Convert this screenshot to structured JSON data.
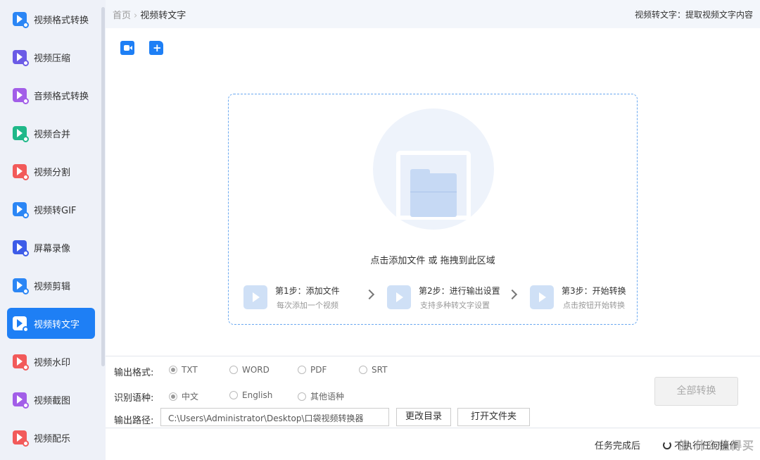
{
  "sidebar": {
    "items": [
      {
        "label": "视频格式转换",
        "icon": "video-convert-icon",
        "color": "#2b86f5"
      },
      {
        "label": "视频压缩",
        "icon": "video-compress-icon",
        "color": "#6b5be6"
      },
      {
        "label": "音频格式转换",
        "icon": "audio-convert-icon",
        "color": "#a25ee8"
      },
      {
        "label": "视频合并",
        "icon": "video-merge-icon",
        "color": "#1fb889"
      },
      {
        "label": "视频分割",
        "icon": "video-split-icon",
        "color": "#f25a5a"
      },
      {
        "label": "视频转GIF",
        "icon": "video-gif-icon",
        "color": "#2b86f5"
      },
      {
        "label": "屏幕录像",
        "icon": "screen-record-icon",
        "color": "#3d5ce8"
      },
      {
        "label": "视频剪辑",
        "icon": "video-edit-icon",
        "color": "#2b86f5"
      },
      {
        "label": "视频转文字",
        "icon": "video-text-icon",
        "color": "#1e7ff5",
        "active": true
      },
      {
        "label": "视频水印",
        "icon": "video-watermark-icon",
        "color": "#f25a5a"
      },
      {
        "label": "视频截图",
        "icon": "video-screenshot-icon",
        "color": "#a25ee8"
      },
      {
        "label": "视频配乐",
        "icon": "video-music-icon",
        "color": "#f25a5a"
      }
    ]
  },
  "header": {
    "breadcrumb_home": "首页",
    "breadcrumb_sep": "›",
    "breadcrumb_current": "视频转文字",
    "description": "视频转文字：提取视频文字内容"
  },
  "dropzone": {
    "hint": "点击添加文件 或 拖拽到此区域",
    "steps": [
      {
        "title": "第1步：添加文件",
        "subtitle": "每次添加一个视频"
      },
      {
        "title": "第2步：进行输出设置",
        "subtitle": "支持多种转文字设置"
      },
      {
        "title": "第3步：开始转换",
        "subtitle": "点击按钮开始转换"
      }
    ]
  },
  "settings": {
    "format_label": "输出格式:",
    "formats": [
      "TXT",
      "WORD",
      "PDF",
      "SRT"
    ],
    "selected_format": "TXT",
    "language_label": "识别语种:",
    "languages": [
      "中文",
      "English",
      "其他语种"
    ],
    "selected_language": "中文",
    "path_label": "输出路径:",
    "path_value": "C:\\Users\\Administrator\\Desktop\\口袋视频转换器",
    "change_dir": "更改目录",
    "open_folder": "打开文件夹",
    "convert_all": "全部转换"
  },
  "footer": {
    "after_task_label": "任务完成后",
    "after_task_value": "不执行任何操作",
    "watermark": "值 什么值得买"
  },
  "colors": {
    "accent": "#1e7ff5",
    "sidebar_bg": "#eef1f8"
  }
}
